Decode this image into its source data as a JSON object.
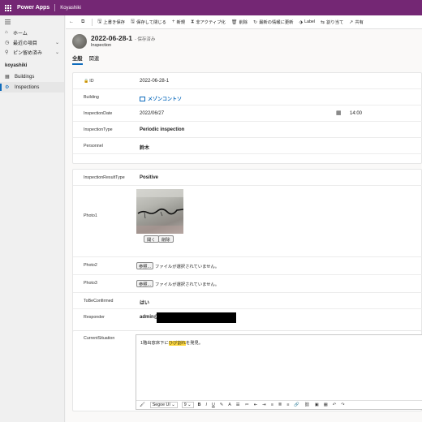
{
  "topbar": {
    "app_name": "Power Apps",
    "environment": "Koyashiki"
  },
  "sidebar": {
    "items": [
      {
        "icon": "home-icon",
        "glyph": "⌂",
        "label": "ホーム"
      },
      {
        "icon": "clock-icon",
        "glyph": "◷",
        "label": "最近の項目",
        "chevron": "⌄"
      },
      {
        "icon": "pin-icon",
        "glyph": "⚲",
        "label": "ピン留め済み",
        "chevron": "⌄"
      }
    ],
    "group_label": "koyashiki",
    "entities": [
      {
        "icon": "table-icon",
        "glyph": "▦",
        "label": "Buildings"
      },
      {
        "icon": "inspections-icon",
        "glyph": "⚙",
        "label": "Inspections"
      }
    ]
  },
  "commands": {
    "back_glyph": "←",
    "popout_glyph": "⧉",
    "items": [
      {
        "glyph": "🖫",
        "label": "上書き保存"
      },
      {
        "glyph": "🖫",
        "label": "保存して閉じる"
      },
      {
        "glyph": "+",
        "label": "新規"
      },
      {
        "glyph": "⧗",
        "label": "非アクティブ化"
      },
      {
        "glyph": "🗑",
        "label": "削除"
      },
      {
        "glyph": "↻",
        "label": "最新の情報に更新"
      },
      {
        "glyph": "⬗",
        "label": "Label"
      },
      {
        "glyph": "⇆",
        "label": "割り当て"
      },
      {
        "glyph": "↗",
        "label": "共有"
      }
    ]
  },
  "record": {
    "title": "2022-06-28-1",
    "status": "- 保存済み",
    "entity": "Inspection",
    "tabs": [
      "全般",
      "関連"
    ]
  },
  "section1": {
    "id_label": "ID",
    "id_value": "2022-06-28-1",
    "building_label": "Building",
    "building_value": "メゾンコントソ",
    "date_label": "InspectionDate",
    "date_value": "2022/06/27",
    "time_value": "14:00",
    "type_label": "InspectionType",
    "type_value": "Periodic inspection",
    "personnel_label": "Personnel",
    "personnel_value": "鈴木"
  },
  "section2": {
    "result_label": "InspectionResultType",
    "result_value": "Positive",
    "photo1_label": "Photo1",
    "open_button": "開く",
    "delete_button": "削除",
    "photo2_label": "Photo2",
    "photo3_label": "Photo3",
    "browse_button": "参照...",
    "no_file_text": "ファイルが選択されていません。",
    "confirm_label": "ToBeConfirmed",
    "confirm_value": "はい",
    "responder_label": "Responder",
    "responder_value": "admin@"
  },
  "section3": {
    "situation_label": "CurrentSituation",
    "text_before": "1階出窓床下に",
    "text_highlight": "ひび割れ",
    "text_after": "を発見。",
    "font_name": "Segoe UI",
    "font_size": "9"
  }
}
